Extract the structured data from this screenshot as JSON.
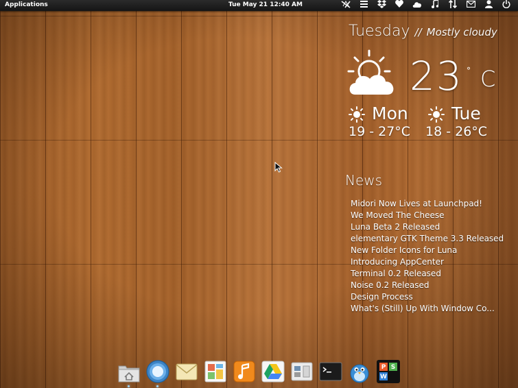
{
  "panel": {
    "applications_label": "Applications",
    "datetime": "Tue May 21 12:40 AM",
    "tray_icons": [
      "network-icon",
      "menu-icon",
      "dropbox-icon",
      "heart-icon",
      "cloud-icon",
      "music-icon",
      "transfer-icon",
      "mail-icon",
      "user-icon",
      "power-icon"
    ]
  },
  "weather": {
    "day": "Tuesday",
    "separator": "//",
    "condition": "Mostly cloudy",
    "temperature": "23",
    "degree_symbol": "°",
    "unit": "C",
    "forecast": [
      {
        "day": "Mon",
        "range": "19 - 27°C"
      },
      {
        "day": "Tue",
        "range": "18 - 26°C"
      }
    ]
  },
  "news": {
    "title": "News",
    "items": [
      "Midori Now Lives at Launchpad!",
      "We Moved The Cheese",
      "Luna Beta 2 Released",
      "elementary GTK Theme 3.3 Released",
      "New Folder Icons for Luna",
      "Introducing AppCenter",
      "Terminal 0.2 Released",
      "Noise 0.2 Released",
      "Design Process",
      "What's (Still) Up With Window Co..."
    ]
  },
  "dock": {
    "items": [
      "files-icon",
      "browser-icon",
      "mail-icon",
      "photos-icon",
      "music-icon",
      "drive-icon",
      "settings-icon",
      "terminal-icon",
      "birdie-icon",
      "office-icon"
    ],
    "running": [
      "files-icon",
      "browser-icon"
    ]
  },
  "colors": {
    "panel": "#1c1c1c",
    "wood": "#a8642c",
    "indicator": "#9fd8ff"
  }
}
